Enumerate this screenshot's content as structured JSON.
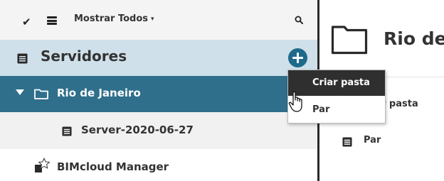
{
  "toolbar": {
    "check_icon": "check-icon",
    "list_icon": "list-icon",
    "filter_label": "Mostrar Todos",
    "filter_caret": "▾",
    "search_icon": "search-icon"
  },
  "tree": {
    "root": {
      "label": "Servidores",
      "icon": "server-icon",
      "add_icon": "plus-icon"
    },
    "folder": {
      "label": "Rio de Janeiro",
      "icon": "folder-icon",
      "expanded": true
    },
    "server": {
      "label": "Server-2020-06-27",
      "icon": "server-icon"
    },
    "manager": {
      "label": "BIMcloud Manager",
      "icon": "manager-icon"
    }
  },
  "detail": {
    "title": "Rio de",
    "items": [
      {
        "label": "r pasta"
      },
      {
        "label": "Par",
        "icon": "server-icon"
      }
    ]
  },
  "context_menu": {
    "items": [
      {
        "label": "Criar pasta",
        "highlighted": true
      },
      {
        "label": "Par",
        "highlighted": false
      }
    ]
  },
  "colors": {
    "toolbar_bg": "#f4f4f4",
    "root_row_bg": "#cfe0ea",
    "selected_row_bg": "#2f6f8c",
    "server_row_bg": "#f1f1f1",
    "add_button": "#1e6a8a",
    "menu_highlight": "#2f2f2f",
    "divider": "#2b2b2b"
  }
}
